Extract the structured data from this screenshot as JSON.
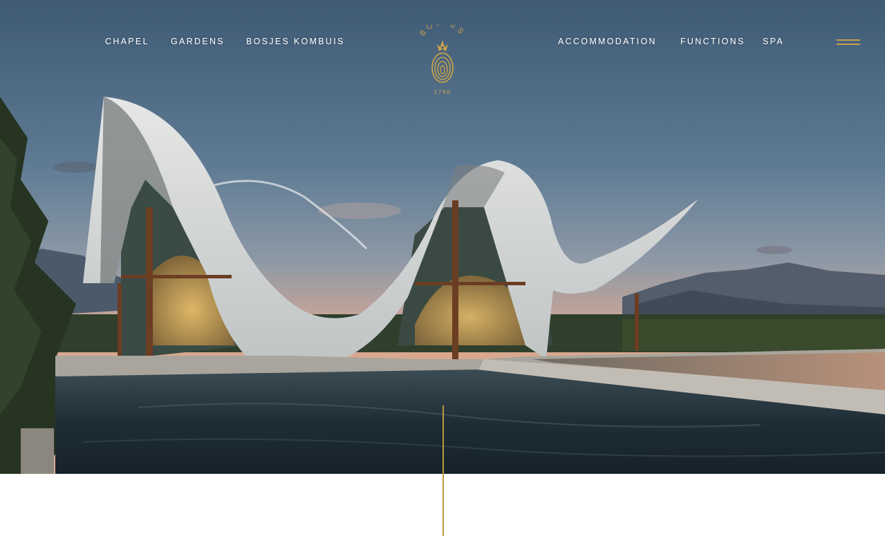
{
  "nav": {
    "left": [
      {
        "label": "CHAPEL"
      },
      {
        "label": "GARDENS"
      },
      {
        "label": "BOSJES KOMBUIS"
      }
    ],
    "right": [
      {
        "label": "ACCOMMODATION"
      },
      {
        "label": "FUNCTIONS"
      },
      {
        "label": "SPA"
      }
    ]
  },
  "logo": {
    "wordmark": "BOSJES",
    "year": "1790",
    "icon": "pineapple-icon"
  },
  "menu": {
    "icon": "hamburger-menu-icon"
  },
  "hero": {
    "image": "chapel-wave-roof-photo"
  },
  "colors": {
    "accent_gold": "#c9a24b",
    "nav_text": "#ffffff",
    "page_background": "#ffffff"
  }
}
